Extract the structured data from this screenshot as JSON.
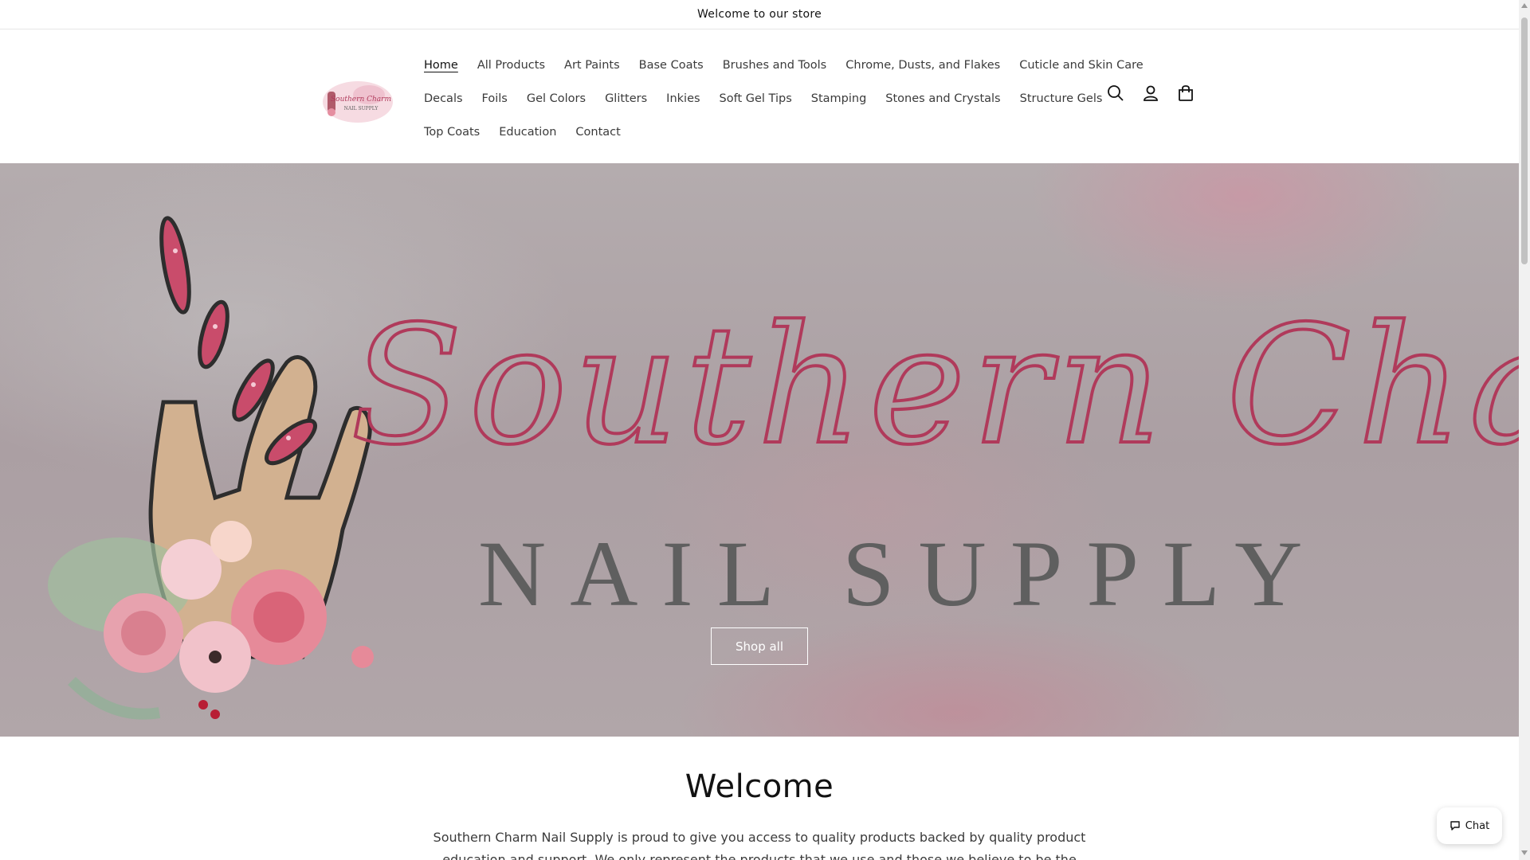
{
  "announcement": {
    "text": "Welcome to our store"
  },
  "header": {
    "logo_text_line1": "Southern Charm",
    "logo_text_line2": "NAIL SUPPLY",
    "nav_rows": [
      [
        "Home",
        "All Products",
        "Art Paints",
        "Base Coats",
        "Brushes and Tools",
        "Chrome, Dusts, and Flakes",
        "Cuticle and Skin Care"
      ],
      [
        "Decals",
        "Foils",
        "Gel Colors",
        "Glitters",
        "Inkies",
        "Soft Gel Tips",
        "Stamping",
        "Stones and Crystals",
        "Structure Gels"
      ],
      [
        "Top Coats",
        "Education",
        "Contact"
      ]
    ],
    "active_item": "Home",
    "icons": [
      "search-icon",
      "account-icon",
      "cart-icon"
    ]
  },
  "hero": {
    "script_text": "Southern Charm",
    "block_text": "NAIL SUPPLY",
    "button_label": "Shop all"
  },
  "welcome": {
    "title": "Welcome",
    "body": "Southern Charm Nail Supply is proud to give you access to quality products backed by quality product education and support. We only represent the products that we use and those we believe to be the very best."
  },
  "chat": {
    "label": "Chat"
  },
  "colors": {
    "accent_pink": "#b03a5b",
    "hero_text_gray": "#5f5f5f",
    "text": "#121212"
  }
}
